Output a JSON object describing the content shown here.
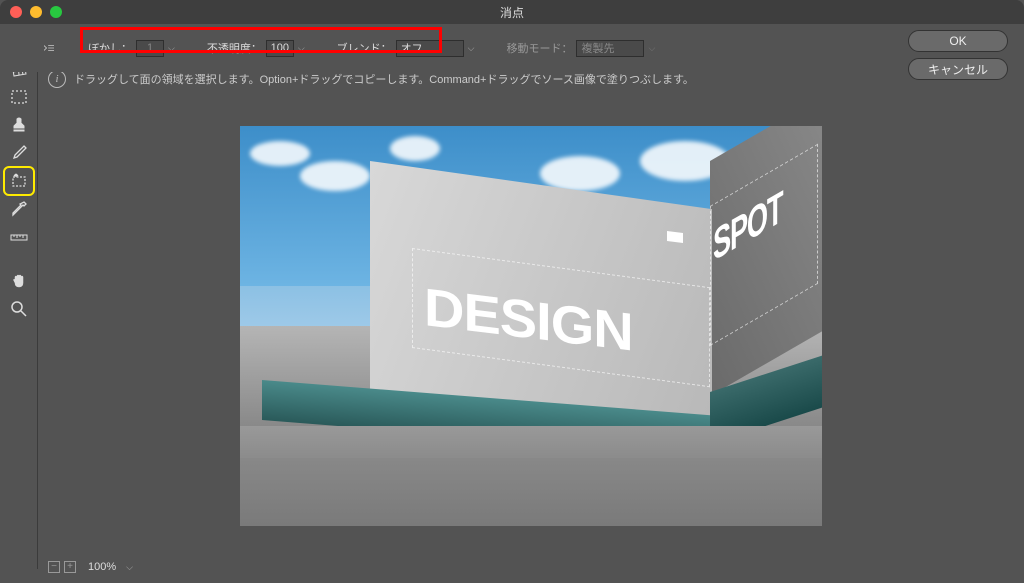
{
  "window": {
    "title": "消点"
  },
  "toolbar": {
    "blur": {
      "label": "ぼかし：",
      "value": "1"
    },
    "opacity": {
      "label": "不透明度：",
      "value": "100"
    },
    "blend": {
      "label": "ブレンド：",
      "value": "オフ"
    },
    "move_mode": {
      "label": "移動モード：",
      "value": "複製先"
    }
  },
  "buttons": {
    "ok": "OK",
    "cancel": "キャンセル"
  },
  "hint": {
    "text": "ドラッグして面の領域を選択します。Option+ドラッグでコピーします。Command+ドラッグでソース画像で塗りつぶします。"
  },
  "canvas": {
    "text_front": "DESIGN",
    "text_side": "SPOT"
  },
  "status": {
    "zoom": "100%"
  },
  "icons": {
    "arrow": "arrow-icon",
    "grid": "grid-icon",
    "marquee": "marquee-icon",
    "stamp": "stamp-icon",
    "brush": "brush-icon",
    "transform": "transform-icon",
    "eyedropper": "eyedropper-icon",
    "ruler": "ruler-icon",
    "hand": "hand-icon",
    "zoom_tool": "zoom-icon"
  }
}
